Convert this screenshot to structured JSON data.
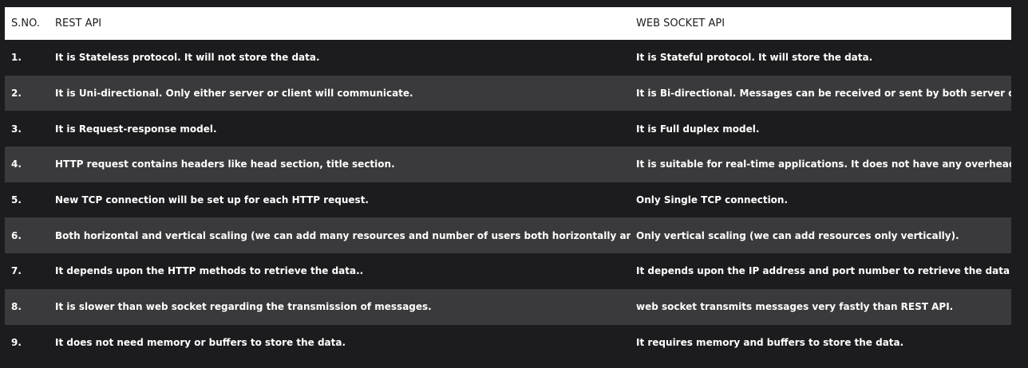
{
  "table": {
    "headers": {
      "sno": "S.NO.",
      "rest": "REST API",
      "ws": "WEB SOCKET API"
    },
    "rows": [
      {
        "sno": "1.",
        "rest": "It is Stateless protocol. It will not store the data.",
        "ws": "It is Stateful protocol. It will store the data."
      },
      {
        "sno": "2.",
        "rest": "It is Uni-directional. Only either server or client will communicate.",
        "ws": "It is Bi-directional. Messages can be received or sent by both server or client."
      },
      {
        "sno": "3.",
        "rest": "It is Request-response model.",
        "ws": "It is Full duplex model."
      },
      {
        "sno": "4.",
        "rest": "HTTP request contains headers like head section, title section.",
        "ws": "It is suitable for real-time applications. It does not have any overhead."
      },
      {
        "sno": "5.",
        "rest": "New TCP connection will be set up for each HTTP request.",
        "ws": "Only Single TCP connection."
      },
      {
        "sno": "6.",
        "rest": "Both horizontal and vertical scaling (we can add many resources and number of users both horizontally and vertically).",
        "ws": "Only vertical scaling (we can add resources only vertically)."
      },
      {
        "sno": "7.",
        "rest": "It depends upon the HTTP methods to retrieve the data..",
        "ws": "It depends upon the IP address and port number to retrieve the data"
      },
      {
        "sno": "8.",
        "rest": "It is slower than web socket regarding the transmission of messages.",
        "ws": "web socket transmits messages very fastly than REST API."
      },
      {
        "sno": "9.",
        "rest": "It does not need memory or buffers to store the data.",
        "ws": "It requires memory and buffers to store the data."
      }
    ]
  }
}
